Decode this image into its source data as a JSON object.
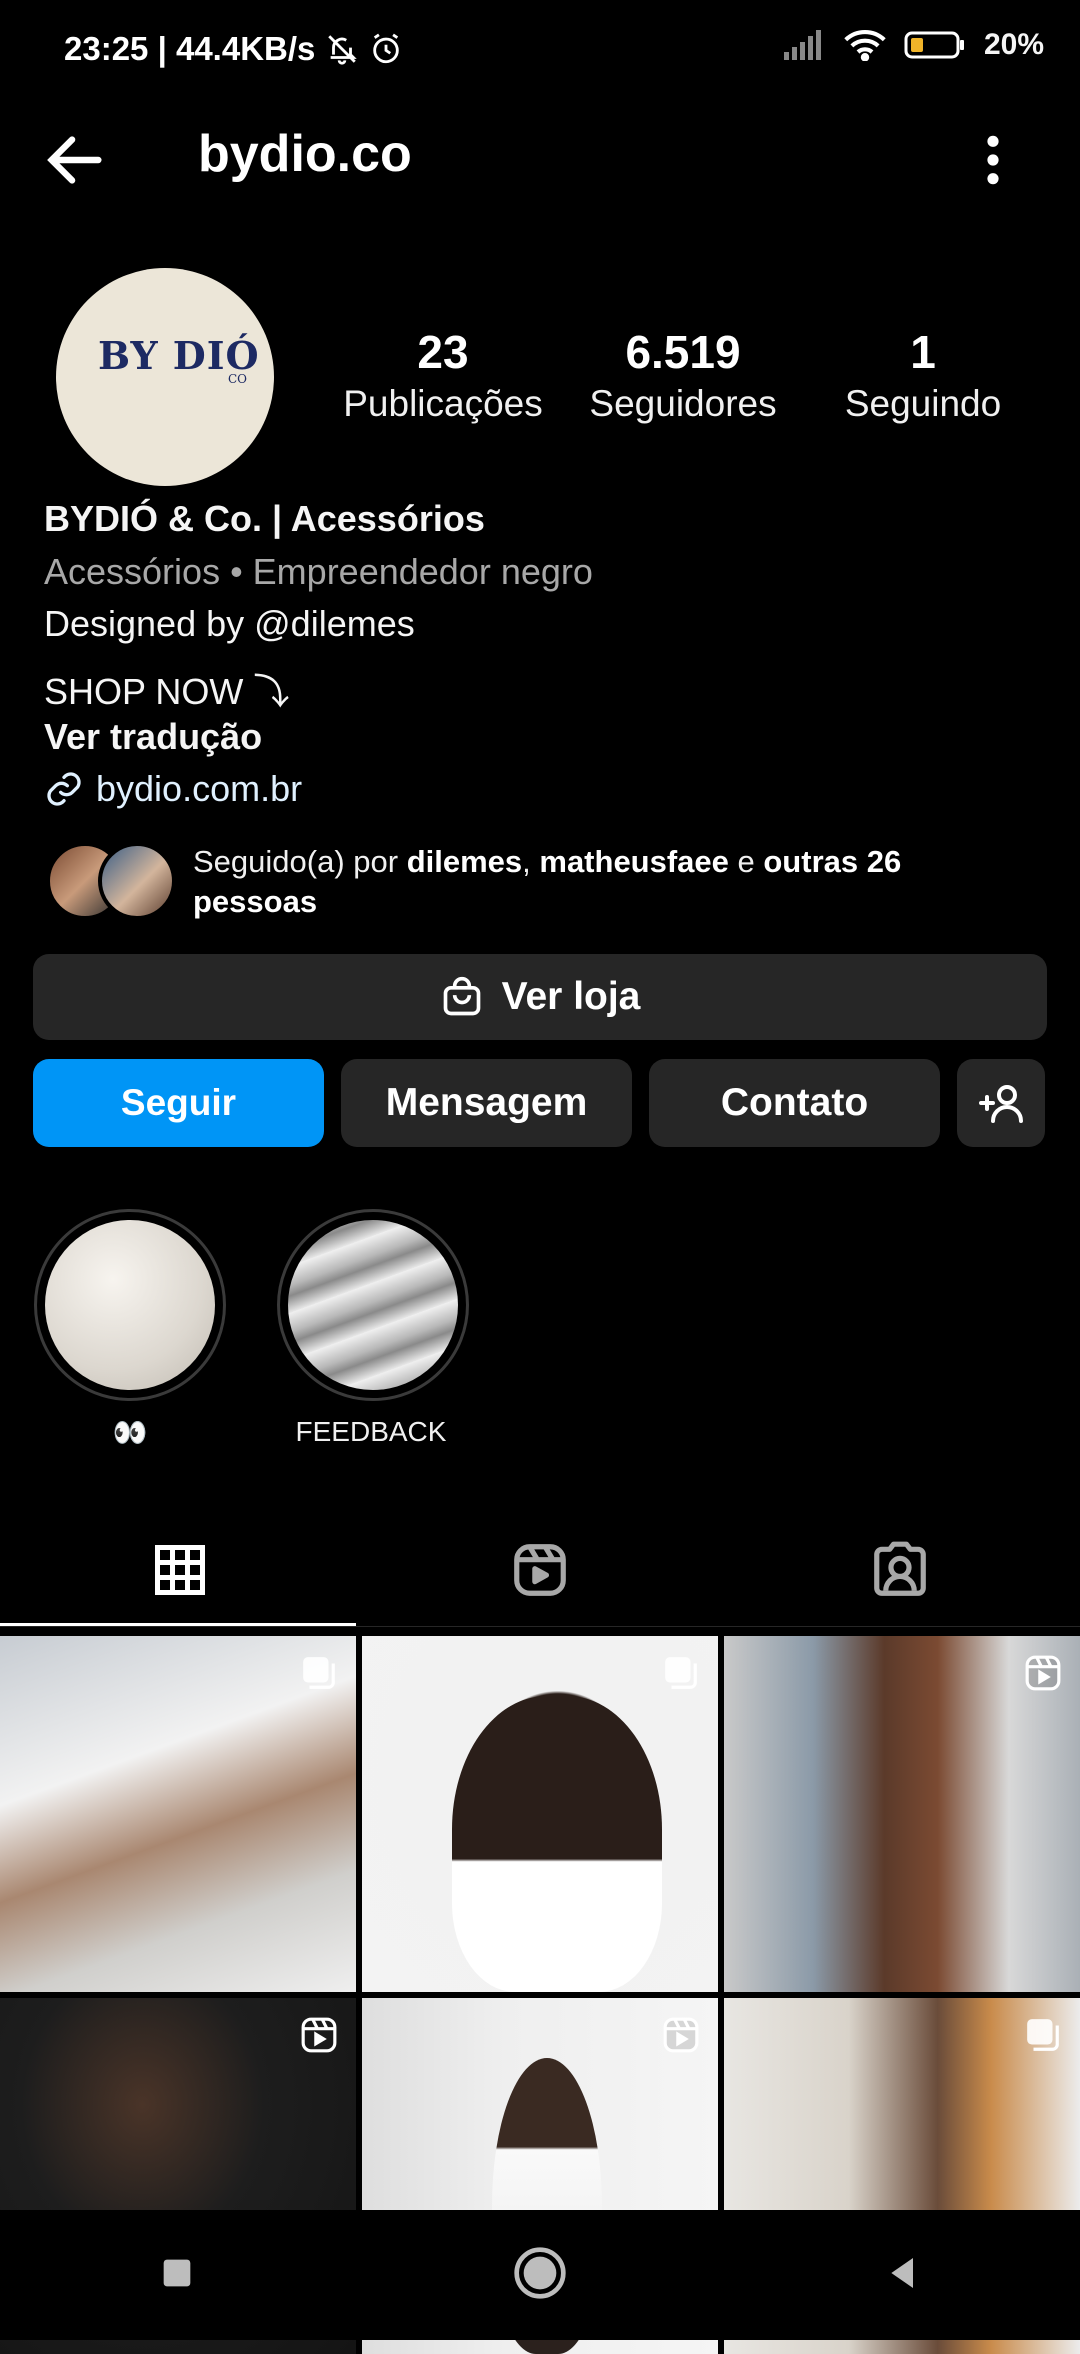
{
  "status_bar": {
    "time_speed": "23:25 | 44.4KB/s",
    "battery": "20%"
  },
  "header": {
    "title": "bydio.co"
  },
  "profile": {
    "avatar_logo_text": "BY DIÓ",
    "avatar_logo_small": "CO",
    "stats": [
      {
        "value": "23",
        "label": "Publicações"
      },
      {
        "value": "6.519",
        "label": "Seguidores"
      },
      {
        "value": "1",
        "label": "Seguindo"
      }
    ],
    "name": "BYDIÓ & Co. | Acessórios",
    "category": "Acessórios • Empreendedor negro",
    "bio_line": "Designed by @dilemes",
    "shop_line": "SHOP NOW ⤵",
    "translate": "Ver tradução",
    "link": "bydio.com.br",
    "followed_by": {
      "prefix": "Seguido(a) por ",
      "user1": "dilemes",
      "sep": ", ",
      "user2": "matheusfaee",
      "and": " e ",
      "others": "outras 26 pessoas"
    }
  },
  "buttons": {
    "shop": "Ver loja",
    "follow": "Seguir",
    "message": "Mensagem",
    "contact": "Contato"
  },
  "highlights": [
    {
      "label": "👀"
    },
    {
      "label": "FEEDBACK"
    }
  ],
  "tabs": [
    {
      "icon": "grid-icon",
      "active": true
    },
    {
      "icon": "reels-icon",
      "active": false
    },
    {
      "icon": "tagged-icon",
      "active": false
    }
  ],
  "posts": [
    {
      "badge": "carousel-icon"
    },
    {
      "badge": "carousel-icon"
    },
    {
      "badge": "reels-icon"
    },
    {
      "badge": "reels-icon"
    },
    {
      "badge": "reels-icon"
    },
    {
      "badge": "carousel-icon"
    }
  ]
}
